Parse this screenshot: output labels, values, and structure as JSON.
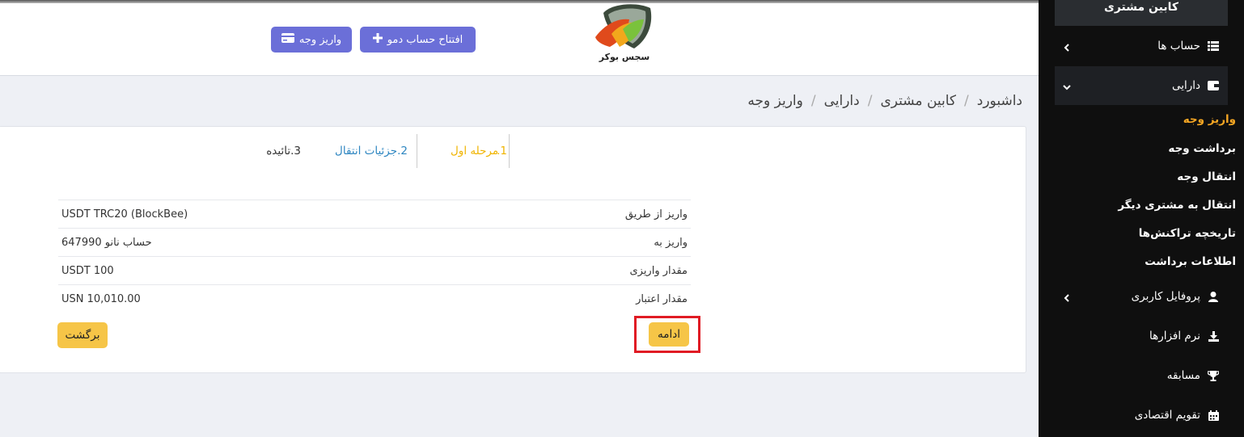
{
  "header": {
    "deposit_button": "واریز وجه",
    "demo_button": "افتتاح حساب دمو",
    "logo_text": "سجس بوکر"
  },
  "breadcrumb": [
    "داشبورد",
    "کابین مشتری",
    "دارایی",
    "واریز وجه"
  ],
  "steps": [
    {
      "label": "مرحله اول",
      "num": "1.",
      "color": "#f0b400"
    },
    {
      "label": "جزئیات انتقال",
      "num": "2.",
      "color": "#2e86c1"
    },
    {
      "label": "تائیده",
      "num": "3.",
      "color": "#333333"
    }
  ],
  "details": [
    {
      "label": "واریز از طریق",
      "value": "USDT TRC20 (BlockBee)"
    },
    {
      "label": "واریز به",
      "value": "حساب نانو 647990"
    },
    {
      "label": "مقدار واریزی",
      "value": "USDT 100"
    },
    {
      "label": "مقدار اعتبار",
      "value": "USN 10,010.00"
    }
  ],
  "buttons": {
    "continue": "ادامه",
    "back": "برگشت"
  },
  "sidebar": {
    "title": "کابین مشتری",
    "items": [
      {
        "label": "حساب ها",
        "icon": "list-icon"
      },
      {
        "label": "دارایی",
        "icon": "wallet-icon"
      },
      {
        "label": "پروفایل کاربری",
        "icon": "user-icon"
      },
      {
        "label": "نرم افزارها",
        "icon": "download-icon"
      },
      {
        "label": "مسابقه",
        "icon": "trophy-icon"
      },
      {
        "label": "تقویم اقتصادی",
        "icon": "calendar-icon"
      }
    ],
    "sub_items": [
      "واریز وجه",
      "برداشت وجه",
      "انتقال وجه",
      "انتقال به مشتری دیگر",
      "تاریخچه تراکنش‌ها",
      "اطلاعات برداشت"
    ]
  },
  "colors": {
    "accent_purple": "#6b6fd8",
    "button_yellow": "#f6c547",
    "active_sub_item": "#f5a623",
    "highlight_red": "#e01b24"
  }
}
